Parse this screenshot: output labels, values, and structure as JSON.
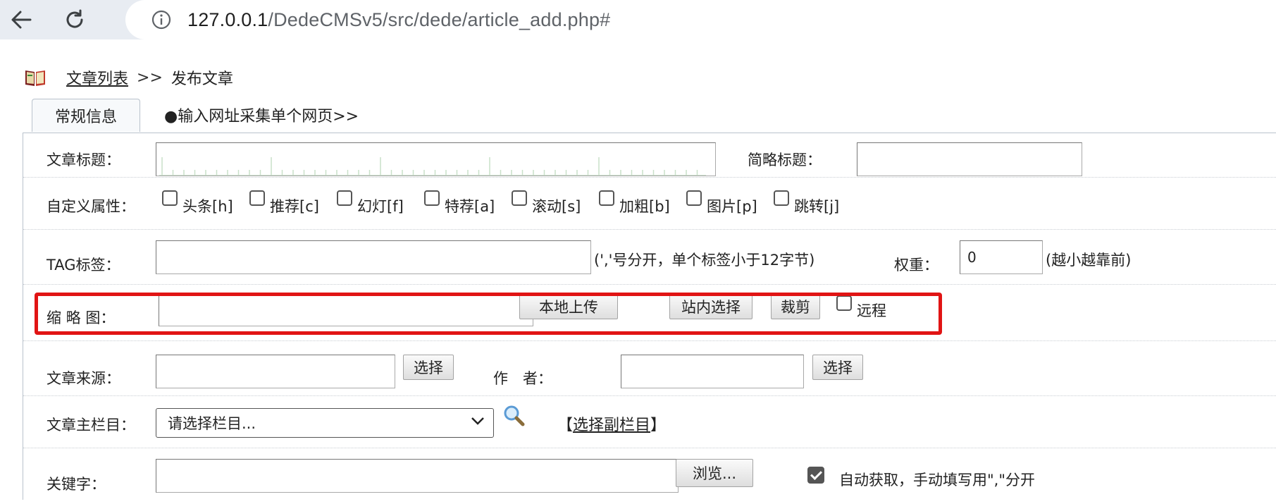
{
  "browser": {
    "url_host": "127.0.0.1",
    "url_path": "/DedeCMSv5/src/dede/article_add.php#",
    "back_icon": "back-arrow-icon",
    "reload_icon": "reload-icon",
    "info_icon": "info-icon"
  },
  "breadcrumb": {
    "link": "文章列表",
    "separator": ">>",
    "current": "发布文章"
  },
  "tabs": {
    "general": "常规信息",
    "collect": "●输入网址采集单个网页>>"
  },
  "form": {
    "title": {
      "label": "文章标题：",
      "value": ""
    },
    "short_title": {
      "label": "简略标题：",
      "value": ""
    },
    "attributes": {
      "label": "自定义属性：",
      "items": [
        {
          "label": "头条[h]",
          "checked": false
        },
        {
          "label": "推荐[c]",
          "checked": false
        },
        {
          "label": "幻灯[f]",
          "checked": false
        },
        {
          "label": "特荐[a]",
          "checked": false
        },
        {
          "label": "滚动[s]",
          "checked": false
        },
        {
          "label": "加粗[b]",
          "checked": false
        },
        {
          "label": "图片[p]",
          "checked": false
        },
        {
          "label": "跳转[j]",
          "checked": false
        }
      ]
    },
    "tags": {
      "label": "TAG标签：",
      "value": "",
      "hint": "(','号分开，单个标签小于12字节)",
      "weight_label": "权重：",
      "weight_value": "0",
      "weight_hint": "(越小越靠前)"
    },
    "thumbnail": {
      "label": "缩 略 图：",
      "value": "",
      "upload_button": "本地上传",
      "site_select_button": "站内选择",
      "crop_button": "裁剪",
      "remote_label": "远程",
      "remote_checked": false
    },
    "source": {
      "label": "文章来源：",
      "value": "",
      "select_button": "选择"
    },
    "author": {
      "label": "作　者：",
      "value": "",
      "select_button": "选择"
    },
    "category": {
      "label": "文章主栏目：",
      "selected": "请选择栏目...",
      "sub_link_left": "【",
      "sub_link": "选择副栏目",
      "sub_link_right": "】"
    },
    "keywords": {
      "label": "关键字：",
      "value": "",
      "browse_button": "浏览...",
      "auto_label": "自动获取，手动填写用\",\"分开",
      "auto_checked": true
    }
  },
  "colors": {
    "highlight_border": "#e11414",
    "chrome_bg": "#e8ecf2"
  }
}
